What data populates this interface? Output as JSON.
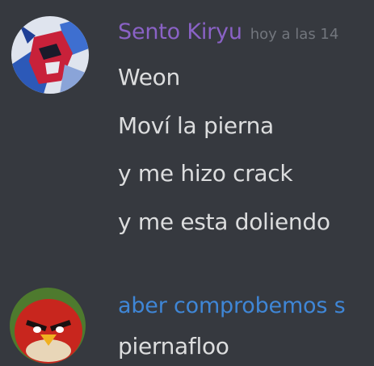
{
  "colors": {
    "background": "#36393f",
    "message_text": "#dcddde",
    "timestamp_text": "#72767d",
    "user1_name": "#8a62c6",
    "user2_name": "#3f86d6"
  },
  "messages": [
    {
      "username": "Sento Kiryu",
      "timestamp": "hoy a las 14",
      "avatar_icon": "masked-rider-avatar-icon",
      "lines": [
        "Weon",
        "Moví la pierna",
        "y me hizo crack",
        "y me esta doliendo"
      ]
    },
    {
      "username": "aber comprobemos s",
      "avatar_icon": "red-bird-avatar-icon",
      "lines": [
        "piernafloo"
      ]
    }
  ]
}
